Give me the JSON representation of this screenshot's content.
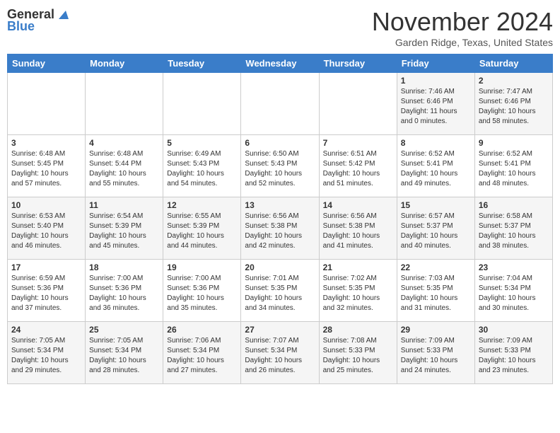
{
  "header": {
    "logo_general": "General",
    "logo_blue": "Blue",
    "month_title": "November 2024",
    "location": "Garden Ridge, Texas, United States"
  },
  "days_of_week": [
    "Sunday",
    "Monday",
    "Tuesday",
    "Wednesday",
    "Thursday",
    "Friday",
    "Saturday"
  ],
  "weeks": [
    [
      {
        "day": "",
        "info": ""
      },
      {
        "day": "",
        "info": ""
      },
      {
        "day": "",
        "info": ""
      },
      {
        "day": "",
        "info": ""
      },
      {
        "day": "",
        "info": ""
      },
      {
        "day": "1",
        "info": "Sunrise: 7:46 AM\nSunset: 6:46 PM\nDaylight: 11 hours and 0 minutes."
      },
      {
        "day": "2",
        "info": "Sunrise: 7:47 AM\nSunset: 6:46 PM\nDaylight: 10 hours and 58 minutes."
      }
    ],
    [
      {
        "day": "3",
        "info": "Sunrise: 6:48 AM\nSunset: 5:45 PM\nDaylight: 10 hours and 57 minutes."
      },
      {
        "day": "4",
        "info": "Sunrise: 6:48 AM\nSunset: 5:44 PM\nDaylight: 10 hours and 55 minutes."
      },
      {
        "day": "5",
        "info": "Sunrise: 6:49 AM\nSunset: 5:43 PM\nDaylight: 10 hours and 54 minutes."
      },
      {
        "day": "6",
        "info": "Sunrise: 6:50 AM\nSunset: 5:43 PM\nDaylight: 10 hours and 52 minutes."
      },
      {
        "day": "7",
        "info": "Sunrise: 6:51 AM\nSunset: 5:42 PM\nDaylight: 10 hours and 51 minutes."
      },
      {
        "day": "8",
        "info": "Sunrise: 6:52 AM\nSunset: 5:41 PM\nDaylight: 10 hours and 49 minutes."
      },
      {
        "day": "9",
        "info": "Sunrise: 6:52 AM\nSunset: 5:41 PM\nDaylight: 10 hours and 48 minutes."
      }
    ],
    [
      {
        "day": "10",
        "info": "Sunrise: 6:53 AM\nSunset: 5:40 PM\nDaylight: 10 hours and 46 minutes."
      },
      {
        "day": "11",
        "info": "Sunrise: 6:54 AM\nSunset: 5:39 PM\nDaylight: 10 hours and 45 minutes."
      },
      {
        "day": "12",
        "info": "Sunrise: 6:55 AM\nSunset: 5:39 PM\nDaylight: 10 hours and 44 minutes."
      },
      {
        "day": "13",
        "info": "Sunrise: 6:56 AM\nSunset: 5:38 PM\nDaylight: 10 hours and 42 minutes."
      },
      {
        "day": "14",
        "info": "Sunrise: 6:56 AM\nSunset: 5:38 PM\nDaylight: 10 hours and 41 minutes."
      },
      {
        "day": "15",
        "info": "Sunrise: 6:57 AM\nSunset: 5:37 PM\nDaylight: 10 hours and 40 minutes."
      },
      {
        "day": "16",
        "info": "Sunrise: 6:58 AM\nSunset: 5:37 PM\nDaylight: 10 hours and 38 minutes."
      }
    ],
    [
      {
        "day": "17",
        "info": "Sunrise: 6:59 AM\nSunset: 5:36 PM\nDaylight: 10 hours and 37 minutes."
      },
      {
        "day": "18",
        "info": "Sunrise: 7:00 AM\nSunset: 5:36 PM\nDaylight: 10 hours and 36 minutes."
      },
      {
        "day": "19",
        "info": "Sunrise: 7:00 AM\nSunset: 5:36 PM\nDaylight: 10 hours and 35 minutes."
      },
      {
        "day": "20",
        "info": "Sunrise: 7:01 AM\nSunset: 5:35 PM\nDaylight: 10 hours and 34 minutes."
      },
      {
        "day": "21",
        "info": "Sunrise: 7:02 AM\nSunset: 5:35 PM\nDaylight: 10 hours and 32 minutes."
      },
      {
        "day": "22",
        "info": "Sunrise: 7:03 AM\nSunset: 5:35 PM\nDaylight: 10 hours and 31 minutes."
      },
      {
        "day": "23",
        "info": "Sunrise: 7:04 AM\nSunset: 5:34 PM\nDaylight: 10 hours and 30 minutes."
      }
    ],
    [
      {
        "day": "24",
        "info": "Sunrise: 7:05 AM\nSunset: 5:34 PM\nDaylight: 10 hours and 29 minutes."
      },
      {
        "day": "25",
        "info": "Sunrise: 7:05 AM\nSunset: 5:34 PM\nDaylight: 10 hours and 28 minutes."
      },
      {
        "day": "26",
        "info": "Sunrise: 7:06 AM\nSunset: 5:34 PM\nDaylight: 10 hours and 27 minutes."
      },
      {
        "day": "27",
        "info": "Sunrise: 7:07 AM\nSunset: 5:34 PM\nDaylight: 10 hours and 26 minutes."
      },
      {
        "day": "28",
        "info": "Sunrise: 7:08 AM\nSunset: 5:33 PM\nDaylight: 10 hours and 25 minutes."
      },
      {
        "day": "29",
        "info": "Sunrise: 7:09 AM\nSunset: 5:33 PM\nDaylight: 10 hours and 24 minutes."
      },
      {
        "day": "30",
        "info": "Sunrise: 7:09 AM\nSunset: 5:33 PM\nDaylight: 10 hours and 23 minutes."
      }
    ]
  ]
}
